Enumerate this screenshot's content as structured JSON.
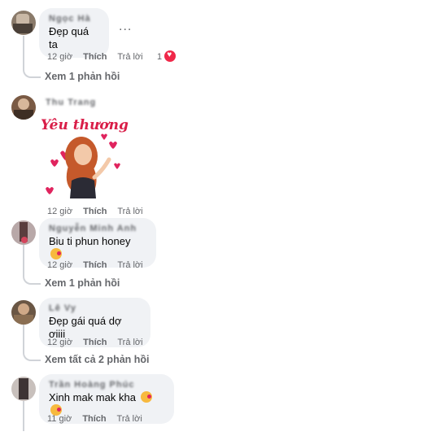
{
  "comments": [
    {
      "author": "Ngọc Hà",
      "text": "Đẹp quá ta",
      "time": "12 giờ",
      "like": "Thích",
      "reply": "Trả lời",
      "reactions": "1",
      "more": "...",
      "view_replies": "Xem 1 phản hồi"
    },
    {
      "author": "Thu Trang",
      "sticker_text": "Yêu thương",
      "time": "12 giờ",
      "like": "Thích",
      "reply": "Trả lời"
    },
    {
      "author": "Nguyễn Minh Anh",
      "text": "Biu ti phun honey",
      "time": "12 giờ",
      "like": "Thích",
      "reply": "Trả lời",
      "view_replies": "Xem 1 phản hồi"
    },
    {
      "author": "Lê Vy",
      "text": "Đẹp gái quá dợ ơiiii",
      "time": "12 giờ",
      "like": "Thích",
      "reply": "Trả lời",
      "view_replies": "Xem tất cả 2 phản hồi"
    },
    {
      "author": "Trần Hoàng Phúc",
      "text": "Xinh mak mak kha",
      "time": "11 giờ",
      "like": "Thích",
      "reply": "Trả lời"
    }
  ],
  "icons": {
    "reaction": "heart-icon",
    "emoji": "kiss-emoji-icon",
    "more": "more-options-icon"
  },
  "colors": {
    "bubble": "#f0f2f5",
    "meta": "#65676b",
    "heart": "#f02849",
    "sticker_text": "#d91e48"
  }
}
